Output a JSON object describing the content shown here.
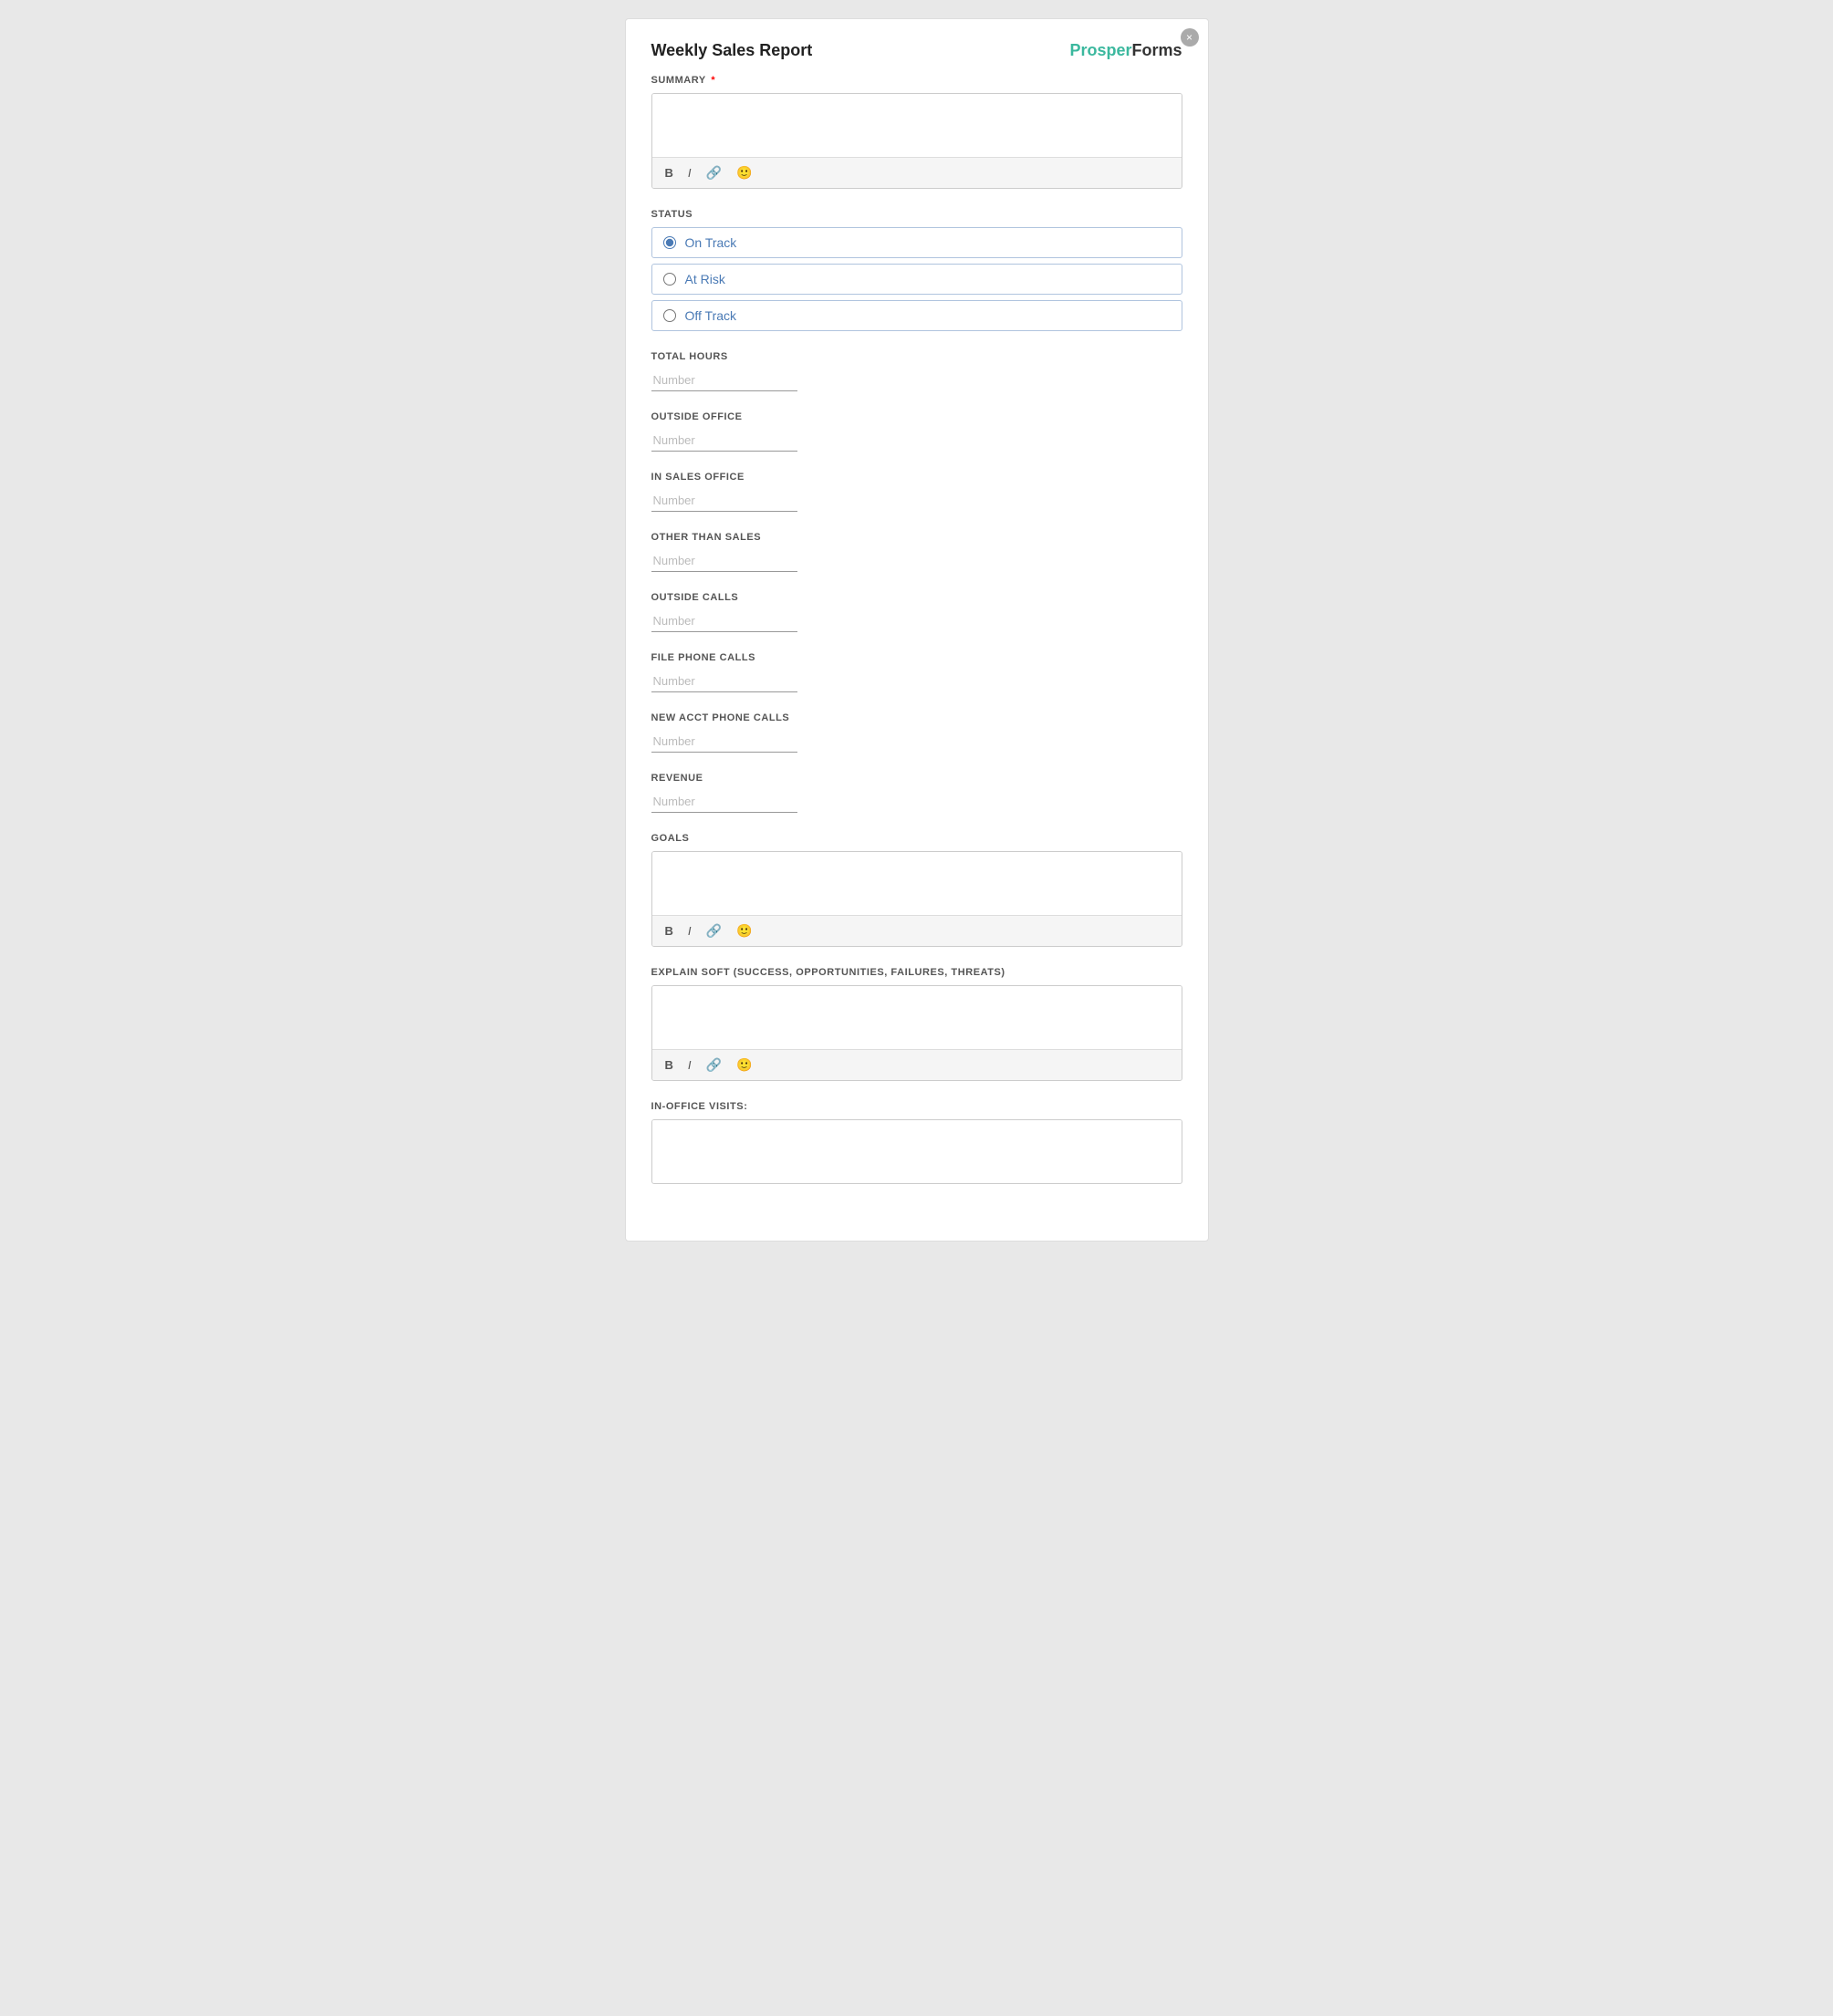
{
  "form": {
    "title": "Weekly Sales Report",
    "close_label": "×",
    "brand": {
      "prosper": "Prosper",
      "forms": "Forms"
    },
    "fields": {
      "summary": {
        "label": "SUMMARY",
        "required": true,
        "placeholder": "",
        "toolbar": {
          "bold": "B",
          "italic": "I",
          "link": "🔗",
          "emoji": "🙂"
        }
      },
      "status": {
        "label": "STATUS",
        "options": [
          {
            "id": "on-track",
            "label": "On Track",
            "checked": true
          },
          {
            "id": "at-risk",
            "label": "At Risk",
            "checked": false
          },
          {
            "id": "off-track",
            "label": "Off Track",
            "checked": false
          }
        ]
      },
      "total_hours": {
        "label": "TOTAL HOURS",
        "placeholder": "Number"
      },
      "outside_office": {
        "label": "OUTSIDE OFFICE",
        "placeholder": "Number"
      },
      "in_sales_office": {
        "label": "IN SALES OFFICE",
        "placeholder": "Number"
      },
      "other_than_sales": {
        "label": "OTHER THAN SALES",
        "placeholder": "Number"
      },
      "outside_calls": {
        "label": "OUTSIDE CALLS",
        "placeholder": "Number"
      },
      "file_phone_calls": {
        "label": "FILE PHONE CALLS",
        "placeholder": "Number"
      },
      "new_acct_phone_calls": {
        "label": "NEW ACCT PHONE CALLS",
        "placeholder": "Number"
      },
      "revenue": {
        "label": "REVENUE",
        "placeholder": "Number"
      },
      "goals": {
        "label": "GOALS",
        "placeholder": "",
        "toolbar": {
          "bold": "B",
          "italic": "I",
          "link": "🔗",
          "emoji": "🙂"
        }
      },
      "explain_soft": {
        "label": "EXPLAIN SOFT (SUCCESS, OPPORTUNITIES, FAILURES, THREATS)",
        "placeholder": "",
        "toolbar": {
          "bold": "B",
          "italic": "I",
          "link": "🔗",
          "emoji": "🙂"
        }
      },
      "in_office_visits": {
        "label": "IN-OFFICE VISITS:",
        "placeholder": ""
      }
    }
  }
}
